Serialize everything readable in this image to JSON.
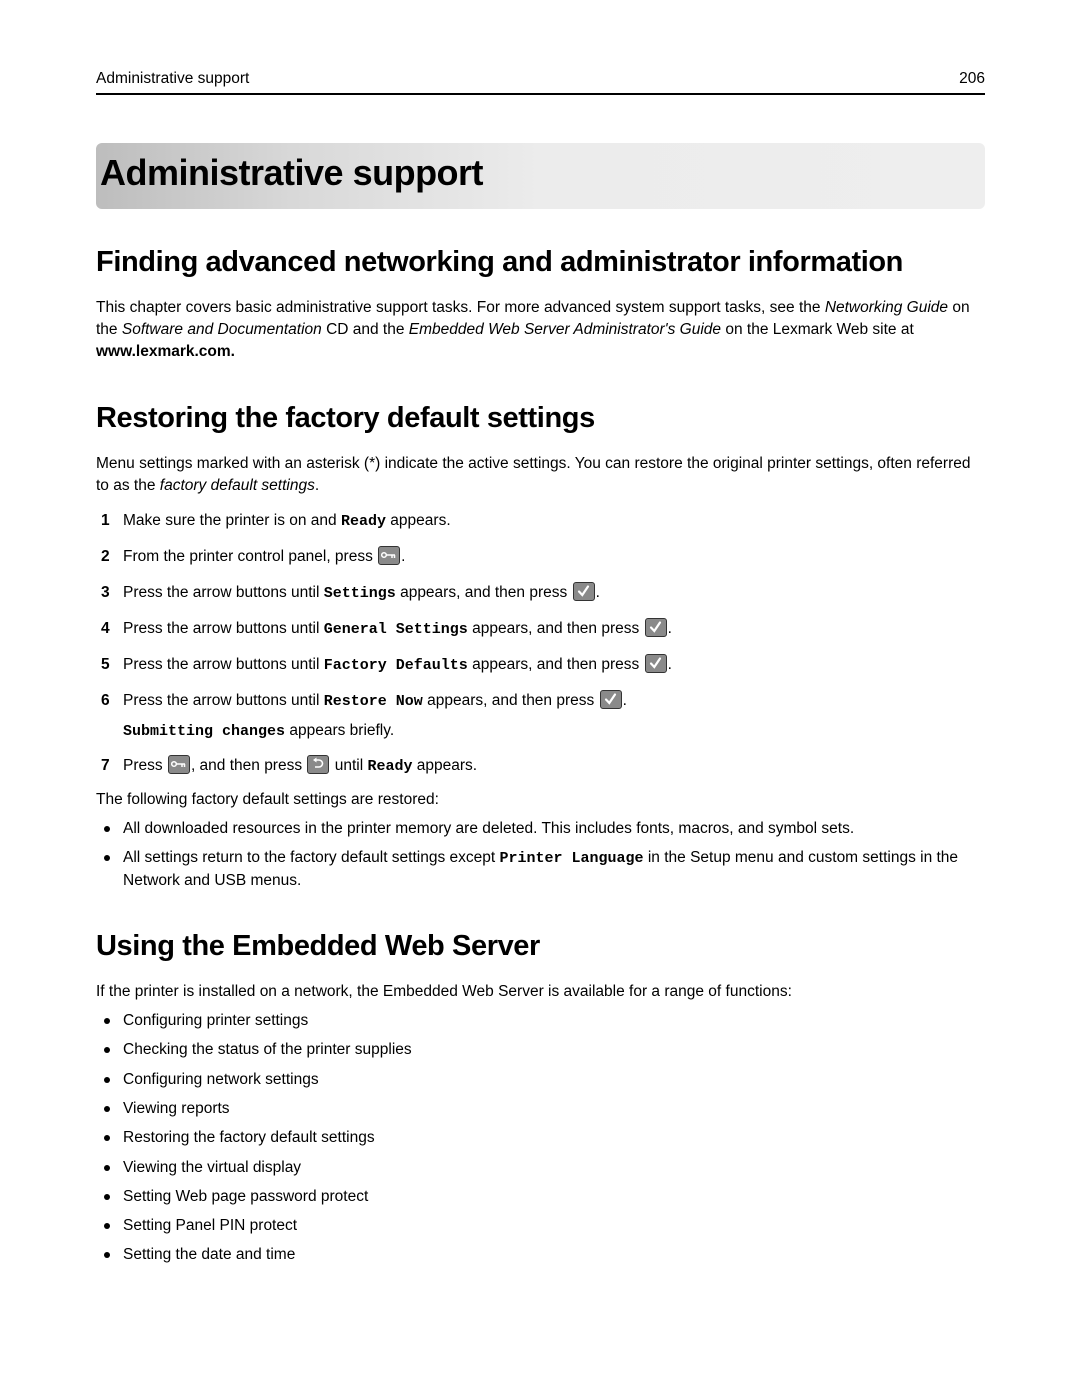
{
  "header": {
    "title": "Administrative support",
    "page_number": "206"
  },
  "chapter_title": "Administrative support",
  "sections": {
    "finding": {
      "heading": "Finding advanced networking and administrator information",
      "para_parts": [
        "This chapter covers basic administrative support tasks. For more advanced system support tasks, see the ",
        "Networking Guide",
        " on the ",
        "Software and Documentation",
        " CD and the ",
        "Embedded Web Server Administrator's Guide",
        " on the Lexmark Web site at ",
        "www.lexmark.com."
      ]
    },
    "restoring": {
      "heading": "Restoring the factory default settings",
      "intro_parts": [
        "Menu settings marked with an asterisk (*) indicate the active settings. You can restore the original printer settings, often referred to as the ",
        "factory default settings",
        "."
      ],
      "steps": [
        {
          "num": "1",
          "a": "Make sure the printer is on and ",
          "code": "Ready",
          "b": " appears."
        },
        {
          "num": "2",
          "a": "From the printer control panel, press ",
          "icon": "key-icon",
          "b": "."
        },
        {
          "num": "3",
          "a": "Press the arrow buttons until ",
          "code": "Settings",
          "b": " appears, and then press ",
          "icon": "checkmark-icon",
          "c": "."
        },
        {
          "num": "4",
          "a": "Press the arrow buttons until ",
          "code": "General Settings",
          "b": " appears, and then press ",
          "icon": "checkmark-icon",
          "c": "."
        },
        {
          "num": "5",
          "a": "Press the arrow buttons until ",
          "code": "Factory Defaults",
          "b": " appears, and then press ",
          "icon": "checkmark-icon",
          "c": "."
        },
        {
          "num": "6",
          "a": "Press the arrow buttons until ",
          "code": "Restore Now",
          "b": " appears, and then press ",
          "icon": "checkmark-icon",
          "c": ".",
          "sub_code": "Submitting changes",
          "sub_text": " appears briefly."
        },
        {
          "num": "7",
          "a": "Press ",
          "icon": "key-icon",
          "b": ", and then press ",
          "icon2": "back-icon",
          "c": " until ",
          "code": "Ready",
          "d": " appears."
        }
      ],
      "restored_intro": "The following factory default settings are restored:",
      "restored_bullets": [
        {
          "text": "All downloaded resources in the printer memory are deleted. This includes fonts, macros, and symbol sets."
        },
        {
          "a": "All settings return to the factory default settings except ",
          "code": "Printer Language",
          "b": " in the Setup menu and custom settings in the Network and USB menus."
        }
      ]
    },
    "ews": {
      "heading": "Using the Embedded Web Server",
      "intro": "If the printer is installed on a network, the Embedded Web Server is available for a range of functions:",
      "bullets": [
        "Configuring printer settings",
        "Checking the status of the printer supplies",
        "Configuring network settings",
        "Viewing reports",
        "Restoring the factory default settings",
        "Viewing the virtual display",
        "Setting Web page password protect",
        "Setting Panel PIN protect",
        "Setting the date and time"
      ]
    }
  }
}
